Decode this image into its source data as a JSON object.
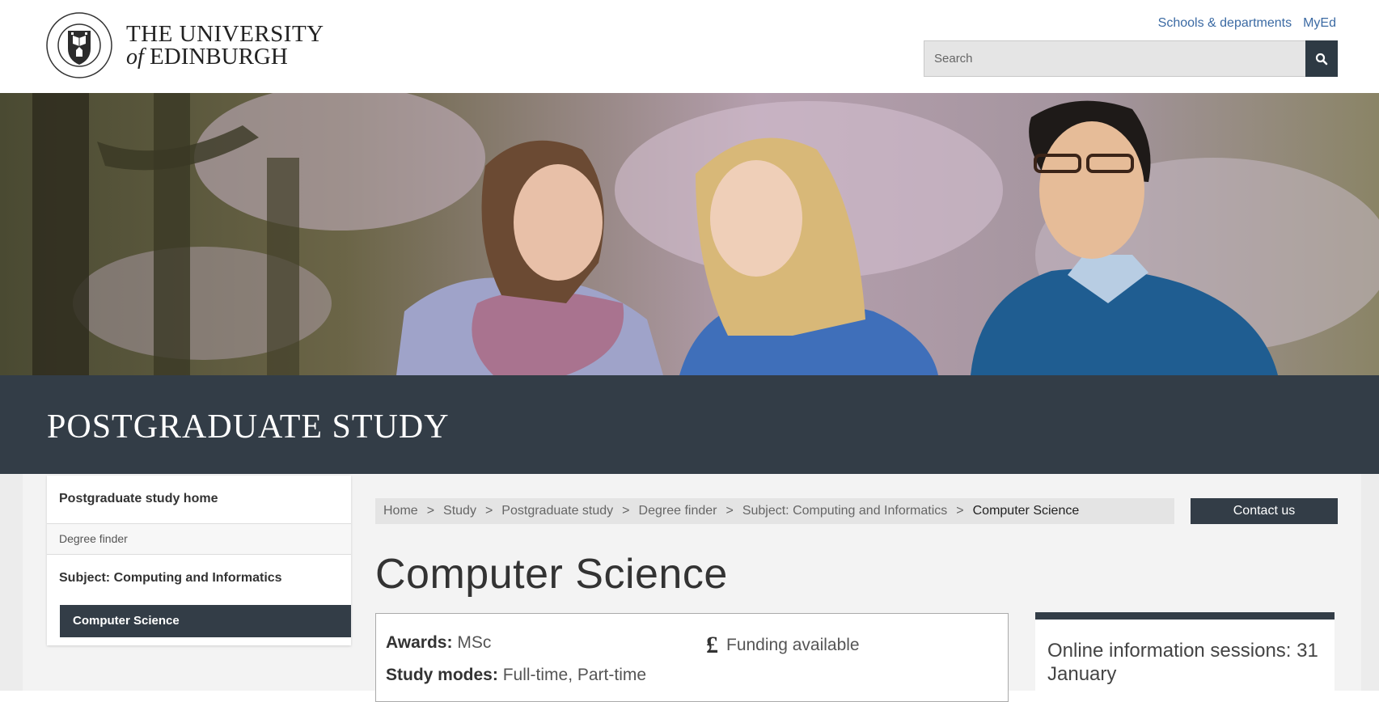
{
  "header": {
    "logo_line1": "THE UNIVERSITY",
    "logo_of": "of",
    "logo_line2": "EDINBURGH",
    "crest_text_top": "THE UNIVERSITY",
    "crest_text_bottom": "OF EDINBURGH",
    "links": [
      "Schools & departments",
      "MyEd"
    ],
    "search_placeholder": "Search",
    "search_icon": "search-icon"
  },
  "banner": {
    "title": "POSTGRADUATE STUDY"
  },
  "sidenav": {
    "home": "Postgraduate study home",
    "finder": "Degree finder",
    "subject": "Subject: Computing and Informatics",
    "current": "Computer Science"
  },
  "breadcrumb": {
    "items": [
      "Home",
      "Study",
      "Postgraduate study",
      "Degree finder",
      "Subject: Computing and Informatics",
      "Computer Science"
    ],
    "separator": ">"
  },
  "contact_label": "Contact us",
  "page_title": "Computer Science",
  "summary": {
    "awards_label": "Awards:",
    "awards_value": "MSc",
    "modes_label": "Study modes:",
    "modes_value": "Full-time, Part-time",
    "funding_icon": "pound-icon",
    "funding_symbol": "£",
    "funding_text": "Funding available"
  },
  "infobox": {
    "text": "Online information sessions: 31 January"
  },
  "colors": {
    "dark_slate": "#333d47",
    "link_blue": "#3b6aa3",
    "crumb_bg": "#e4e4e4"
  }
}
